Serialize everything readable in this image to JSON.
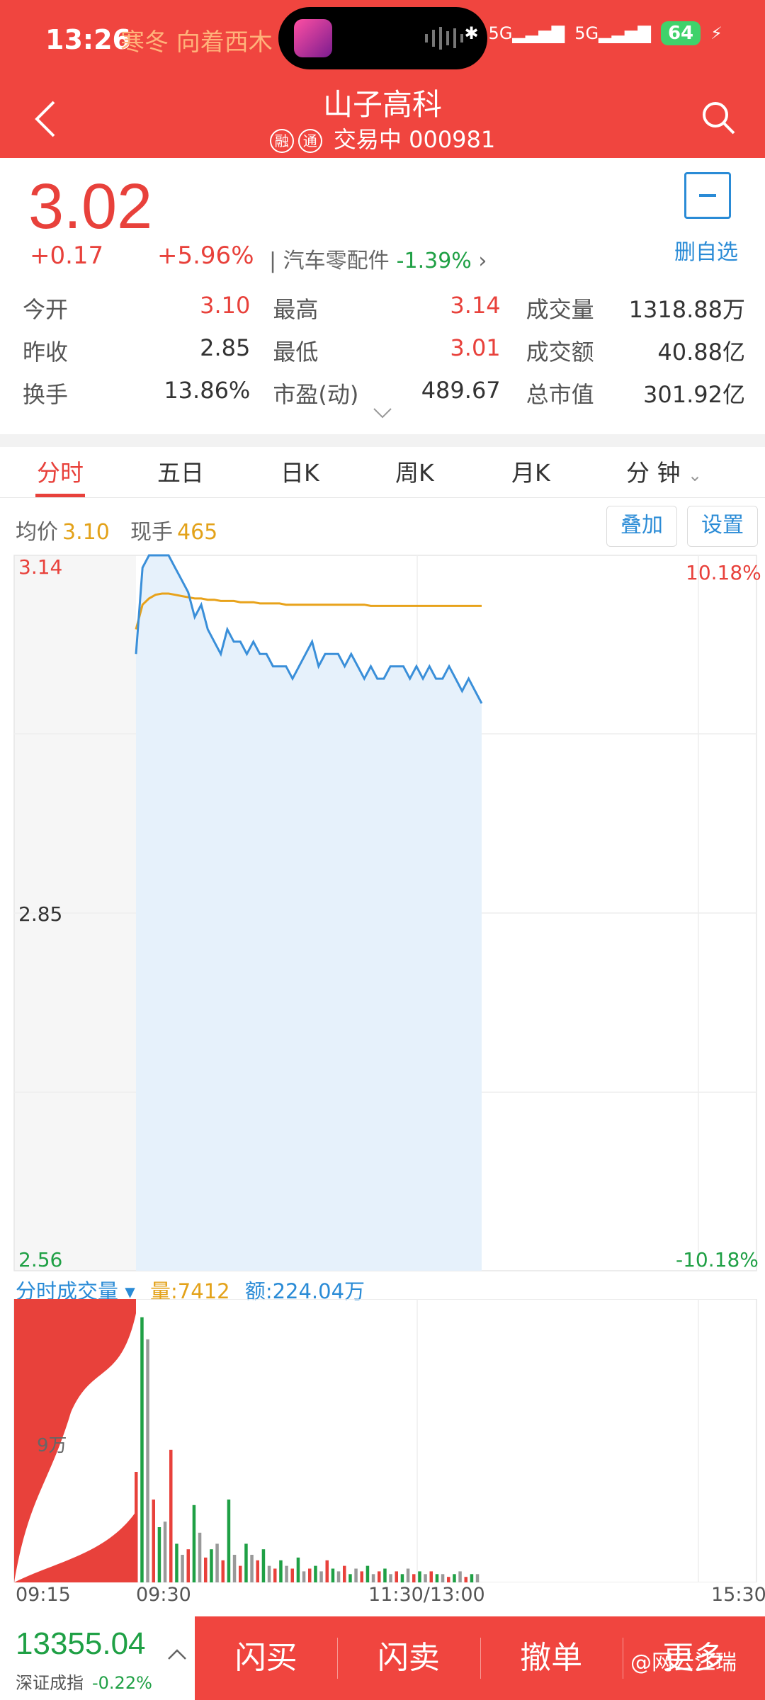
{
  "status_bar": {
    "time": "13:26",
    "ticker": "寒冬 向着西木",
    "network": "5G",
    "battery": "64"
  },
  "header": {
    "title": "山子高科",
    "tag_rong": "融",
    "tag_tong": "通",
    "status": "交易中",
    "code": "000981"
  },
  "quote": {
    "price": "3.02",
    "change": "+0.17",
    "change_pct": "+5.96%",
    "sector": "汽车零配件",
    "sector_change": "-1.39%",
    "favorite_label": "删自选",
    "stats": [
      [
        {
          "k": "今开",
          "v": "3.10",
          "color": "red"
        },
        {
          "k": "最高",
          "v": "3.14",
          "color": "red"
        },
        {
          "k": "成交量",
          "v": "1318.88万",
          "color": "dark"
        }
      ],
      [
        {
          "k": "昨收",
          "v": "2.85",
          "color": "dark"
        },
        {
          "k": "最低",
          "v": "3.01",
          "color": "red"
        },
        {
          "k": "成交额",
          "v": "40.88亿",
          "color": "dark"
        }
      ],
      [
        {
          "k": "换手",
          "v": "13.86%",
          "color": "dark"
        },
        {
          "k": "市盈(动)",
          "v": "489.67",
          "color": "dark"
        },
        {
          "k": "总市值",
          "v": "301.92亿",
          "color": "dark"
        }
      ]
    ]
  },
  "tabs": [
    "分时",
    "五日",
    "日K",
    "周K",
    "月K",
    "分 钟"
  ],
  "info": {
    "avg_label": "均价",
    "avg_value": "3.10",
    "cur_label": "现手",
    "cur_value": "465",
    "overlay_btn": "叠加",
    "settings_btn": "设置"
  },
  "chart_data": {
    "type": "line",
    "price_high_label": "3.14",
    "price_mid_label": "2.85",
    "price_low_label": "2.56",
    "pct_high_label": "10.18%",
    "pct_low_label": "-10.18%",
    "ylim": [
      2.56,
      3.14
    ],
    "x_ticks": [
      "09:15",
      "09:30",
      "11:30/13:00",
      "15:30"
    ],
    "series": [
      {
        "values": [
          3.06,
          3.13,
          3.14,
          3.14,
          3.14,
          3.14,
          3.13,
          3.12,
          3.11,
          3.09,
          3.1,
          3.08,
          3.07,
          3.06,
          3.08,
          3.07,
          3.07,
          3.06,
          3.07,
          3.06,
          3.06,
          3.05,
          3.05,
          3.05,
          3.04,
          3.05,
          3.06,
          3.07,
          3.05,
          3.06,
          3.06,
          3.06,
          3.05,
          3.06,
          3.05,
          3.04,
          3.05,
          3.04,
          3.04,
          3.05,
          3.05,
          3.05,
          3.04,
          3.05,
          3.04,
          3.05,
          3.04,
          3.04,
          3.05,
          3.04,
          3.03,
          3.04,
          3.03,
          3.02
        ]
      },
      {
        "values": [
          3.08,
          3.1,
          3.105,
          3.108,
          3.109,
          3.109,
          3.108,
          3.107,
          3.106,
          3.105,
          3.105,
          3.104,
          3.104,
          3.103,
          3.103,
          3.103,
          3.102,
          3.102,
          3.102,
          3.101,
          3.101,
          3.101,
          3.101,
          3.1,
          3.1,
          3.1,
          3.1,
          3.1,
          3.1,
          3.1,
          3.1,
          3.1,
          3.1,
          3.1,
          3.1,
          3.1,
          3.099,
          3.099,
          3.099,
          3.099,
          3.099,
          3.099,
          3.099,
          3.099,
          3.099,
          3.099,
          3.099,
          3.099,
          3.099,
          3.099,
          3.099,
          3.099,
          3.099,
          3.099
        ]
      }
    ]
  },
  "volume": {
    "title": "分时成交量",
    "vol_label": "量:7412",
    "amt_label": "额:224.04万",
    "mid_label": "9万",
    "bars": [
      40,
      96,
      88,
      30,
      20,
      22,
      48,
      14,
      10,
      12,
      28,
      18,
      9,
      12,
      14,
      8,
      30,
      10,
      6,
      14,
      10,
      8,
      12,
      6,
      5,
      8,
      6,
      5,
      9,
      4,
      5,
      6,
      4,
      8,
      5,
      4,
      6,
      3,
      5,
      4,
      6,
      3,
      4,
      5,
      3,
      4,
      3,
      5,
      3,
      4,
      3,
      4,
      3,
      3,
      2,
      3,
      4,
      2,
      3,
      3
    ]
  },
  "bottom": {
    "index_value": "13355.04",
    "index_name": "深证成指",
    "index_change": "-0.22%",
    "actions": [
      "闪买",
      "闪卖",
      "撤单",
      "更多"
    ],
    "watermark": "@网云江瑞"
  }
}
